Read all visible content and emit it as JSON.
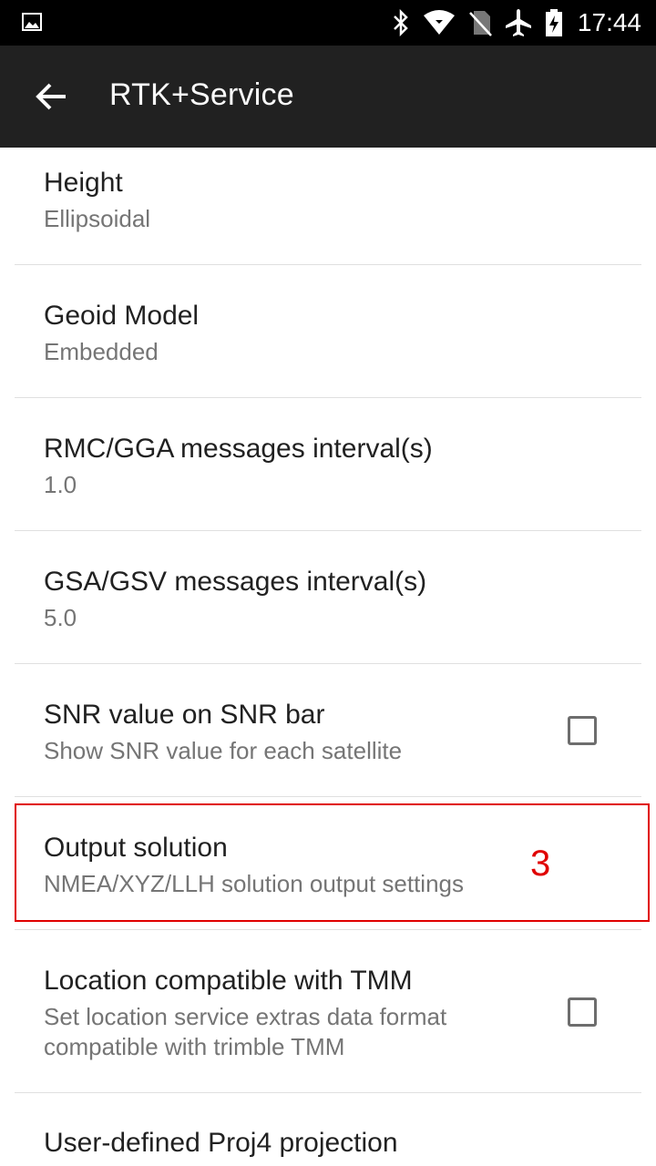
{
  "status_bar": {
    "time": "17:44",
    "icons": [
      "gallery-icon",
      "bluetooth-icon",
      "wifi-icon",
      "no-sim-icon",
      "airplane-icon",
      "battery-charging-icon"
    ]
  },
  "app_bar": {
    "title": "RTK+Service",
    "back_icon": "arrow-left-icon"
  },
  "preferences": [
    {
      "title": "Height",
      "summary": "Ellipsoidal"
    },
    {
      "title": "Geoid Model",
      "summary": "Embedded"
    },
    {
      "title": "RMC/GGA messages interval(s)",
      "summary": "1.0"
    },
    {
      "title": "GSA/GSV messages interval(s)",
      "summary": "5.0"
    },
    {
      "title": "SNR value on SNR bar",
      "summary": "Show SNR value for each satellite",
      "checked": false
    },
    {
      "title": "Output solution",
      "summary": "NMEA/XYZ/LLH solution output settings"
    },
    {
      "title": "Location compatible with TMM",
      "summary_line1": "Set location service extras data format",
      "summary_line2": "compatible with trimble TMM",
      "checked": false
    },
    {
      "title": "User-defined Proj4 projection"
    }
  ],
  "annotation": {
    "label": "3",
    "color": "#e00000"
  },
  "colors": {
    "status_bar": "#000000",
    "app_bar": "#212121",
    "title_text": "#212121",
    "summary_text": "#757575",
    "divider": "#e0e0e0"
  }
}
